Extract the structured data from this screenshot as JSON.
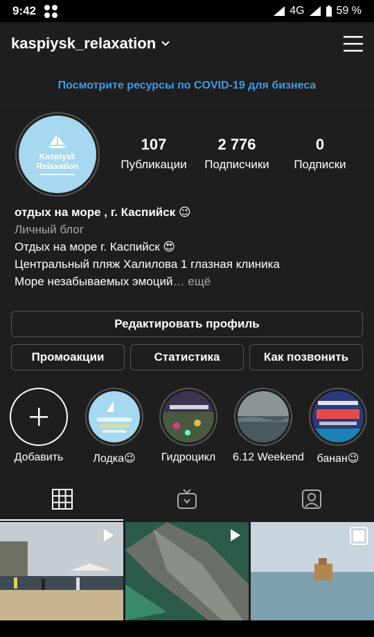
{
  "status": {
    "time": "9:42",
    "network": "4G",
    "battery": "59 %"
  },
  "header": {
    "username": "kaspiysk_relaxation"
  },
  "banner": {
    "text": "Посмотрите ресурсы по COVID-19 для бизнеса"
  },
  "avatar": {
    "line1": "Kaspiysk",
    "line2": "Relaxation"
  },
  "stats": [
    {
      "value": "107",
      "label": "Публикации"
    },
    {
      "value": "2 776",
      "label": "Подписчики"
    },
    {
      "value": "0",
      "label": "Подписки"
    }
  ],
  "bio": {
    "name": "отдых на море , г. Каспийск 😉",
    "category": "Личный блог",
    "line1": "Отдых на море г. Каспийск 😍",
    "line2": "Центральный пляж Халилова 1 глазная клиника",
    "line3": "Море незабываемых эмоций",
    "more": "… ещё"
  },
  "buttons": {
    "edit": "Редактировать профиль",
    "promo": "Промоакции",
    "stats": "Статистика",
    "contact": "Как позвонить"
  },
  "highlights": [
    {
      "label": "Добавить",
      "kind": "add"
    },
    {
      "label": "Лодка😉",
      "kind": "image",
      "color": "#a6d8ef"
    },
    {
      "label": "Гидроцикл",
      "kind": "image",
      "color": "#3b3350"
    },
    {
      "label": "6.12 Weekend",
      "kind": "image",
      "color": "#5c6b6d"
    },
    {
      "label": "банан😉",
      "kind": "image",
      "color": "#2a3a7a"
    }
  ],
  "tabs": [
    "grid-icon",
    "igtv-icon",
    "tagged-icon"
  ],
  "colors": {
    "background": "#1e1e1e",
    "link": "#3d9be9",
    "secondary": "#a8a8a8",
    "border": "#555555"
  }
}
